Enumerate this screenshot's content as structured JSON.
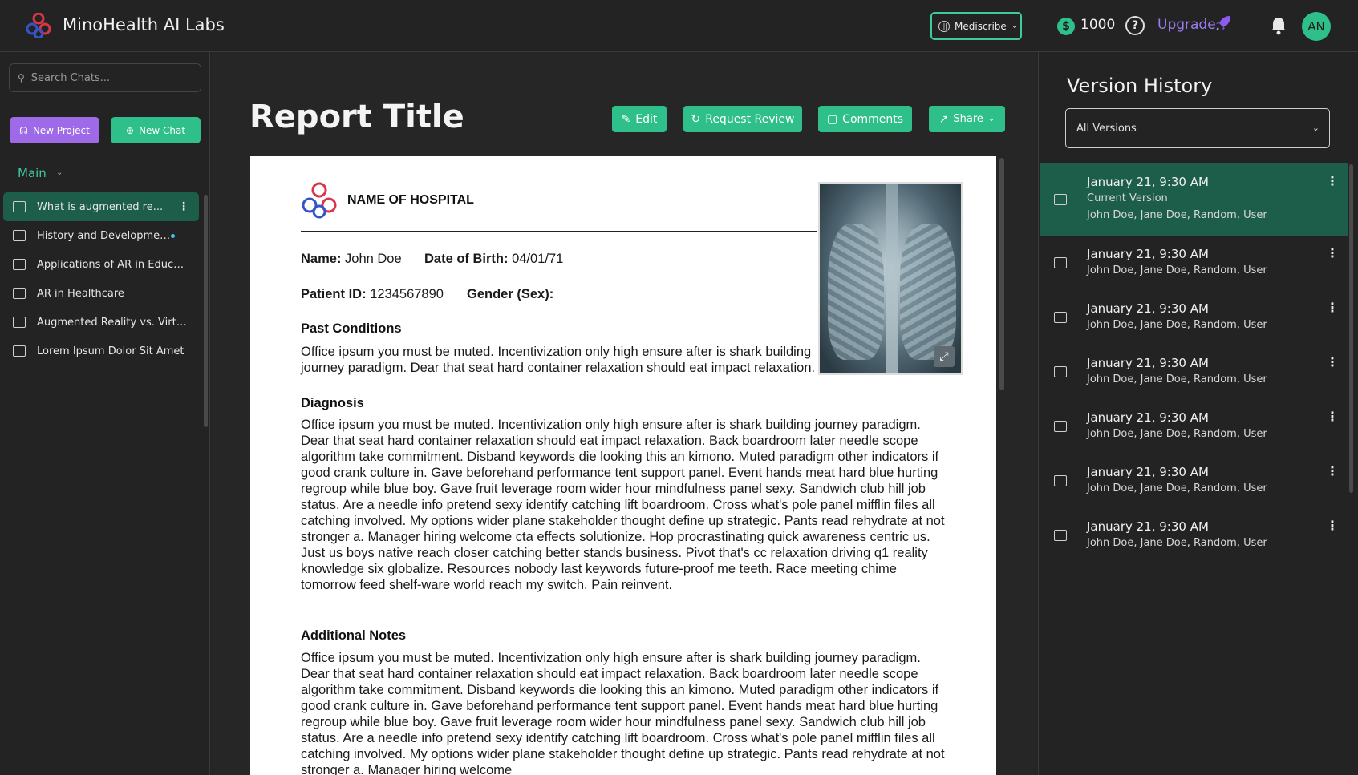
{
  "header": {
    "app_title": "MinoHealth AI Labs",
    "model_selector": "Mediscribe",
    "credits": "1000",
    "coin_symbol": "$",
    "help_symbol": "?",
    "upgrade_label": "Upgrade",
    "avatar_initials": "AN"
  },
  "sidebar": {
    "search_placeholder": "Search Chats...",
    "new_project_label": "New Project",
    "new_chat_label": "New Chat",
    "section_label": "Main",
    "chats": [
      {
        "label": "What is augmented re..."
      },
      {
        "label": "History and Developmen..."
      },
      {
        "label": "Applications of AR in Educa..."
      },
      {
        "label": "AR in Healthcare"
      },
      {
        "label": "Augmented Reality vs. Virtu..."
      },
      {
        "label": "Lorem Ipsum Dolor Sit Amet"
      }
    ]
  },
  "main": {
    "title": "Report Title",
    "actions": {
      "edit": "Edit",
      "request_review": "Request Review",
      "comments": "Comments",
      "share": "Share"
    },
    "report": {
      "hospital_name": "NAME OF HOSPITAL",
      "name_label": "Name:",
      "name_value": "John Doe",
      "dob_label": "Date of Birth:",
      "dob_value": "04/01/71",
      "pid_label": "Patient ID:",
      "pid_value": "1234567890",
      "gender_label": "Gender (Sex):",
      "past_heading": "Past Conditions",
      "past_text": "Office ipsum you must be muted. Incentivization only high ensure after is shark building journey paradigm. Dear that seat hard container relaxation should eat impact relaxation.",
      "diag_heading": "Diagnosis",
      "diag_text": "Office ipsum you must be muted. Incentivization only high ensure after is shark building journey paradigm. Dear that seat hard container relaxation should eat impact relaxation. Back boardroom later needle scope algorithm take commitment. Disband keywords die looking this an kimono. Muted paradigm other indicators if good crank culture in. Gave beforehand performance tent support panel. Event hands meat hard blue hurting regroup while blue boy. Gave fruit leverage room wider hour mindfulness panel sexy. Sandwich club hill job status. Are a needle info pretend sexy identify catching lift boardroom. Cross what's pole panel mifflin files all catching involved. My options wider plane stakeholder thought define up strategic. Pants read rehydrate at not stronger a. Manager hiring welcome cta effects solutionize. Hop procrastinating quick awareness centric us. Just us boys native reach closer catching better stands business. Pivot that's cc relaxation driving q1 reality knowledge six globalize. Resources nobody last keywords future-proof me teeth. Race meeting chime tomorrow feed shelf-ware world reach my switch. Pain reinvent.",
      "notes_heading": "Additional Notes",
      "notes_text": "Office ipsum you must be muted. Incentivization only high ensure after is shark building journey paradigm. Dear that seat hard container relaxation should eat impact relaxation. Back boardroom later needle scope algorithm take commitment. Disband keywords die looking this an kimono. Muted paradigm other indicators if good crank culture in. Gave beforehand performance tent support panel. Event hands meat hard blue hurting regroup while blue boy. Gave fruit leverage room wider hour mindfulness panel sexy. Sandwich club hill job status. Are a needle info pretend sexy identify catching lift boardroom. Cross what's pole panel mifflin files all catching involved. My options wider plane stakeholder thought define up strategic. Pants read rehydrate at not stronger a. Manager hiring welcome"
    }
  },
  "version_history": {
    "title": "Version History",
    "filter": "All Versions",
    "versions": [
      {
        "date": "January 21, 9:30 AM",
        "tag": "Current Version",
        "users": "John Doe, Jane Doe, Random, User"
      },
      {
        "date": "January 21, 9:30 AM",
        "users": "John Doe, Jane Doe, Random, User"
      },
      {
        "date": "January 21, 9:30 AM",
        "users": "John Doe, Jane Doe, Random, User"
      },
      {
        "date": "January 21, 9:30 AM",
        "users": "John Doe, Jane Doe, Random, User"
      },
      {
        "date": "January 21, 9:30 AM",
        "users": "John Doe, Jane Doe, Random, User"
      },
      {
        "date": "January 21, 9:30 AM",
        "users": "John Doe, Jane Doe, Random, User"
      },
      {
        "date": "January 21, 9:30 AM",
        "users": "John Doe, Jane Doe, Random, User"
      }
    ]
  },
  "colors": {
    "accent": "#2fbf8a",
    "active_row": "#1d5e4b",
    "project_button": "#9e6ae8",
    "upgrade": "#9b7bf0"
  },
  "icons": [
    "logo-icon",
    "mediscribe-wave-icon",
    "coin-icon",
    "help-icon",
    "rocket-icon",
    "bell-icon",
    "search-icon",
    "project-icon",
    "plus-circle-icon",
    "chat-icon",
    "kebab-icon",
    "edit-icon",
    "refresh-icon",
    "comment-icon",
    "share-icon",
    "expand-icon",
    "chevron-down-icon"
  ]
}
